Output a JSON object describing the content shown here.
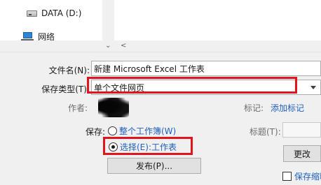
{
  "nav": {
    "items": [
      {
        "label": "DATA (D:)",
        "icon": "drive-icon"
      },
      {
        "label": "网络",
        "icon": "network-icon"
      }
    ]
  },
  "form": {
    "filename_label": "文件名(N):",
    "filename_value": "新建 Microsoft Excel 工作表",
    "savetype_label": "保存类型(T):",
    "savetype_value": "单个文件网页",
    "author_label": "作者:",
    "tags_label": "标记:",
    "tags_link": "添加标记",
    "save_label": "保存:",
    "option_workbook": "整个工作簿(W)",
    "option_selection": "选择(E):工作表",
    "title_label": "标题(T):",
    "publish_button": "发布(P)...",
    "change_button": "更改",
    "save_thumbnail_label": "保存缩略"
  },
  "colors": {
    "highlight_border": "#e0141e",
    "link": "#1f5fbf"
  }
}
